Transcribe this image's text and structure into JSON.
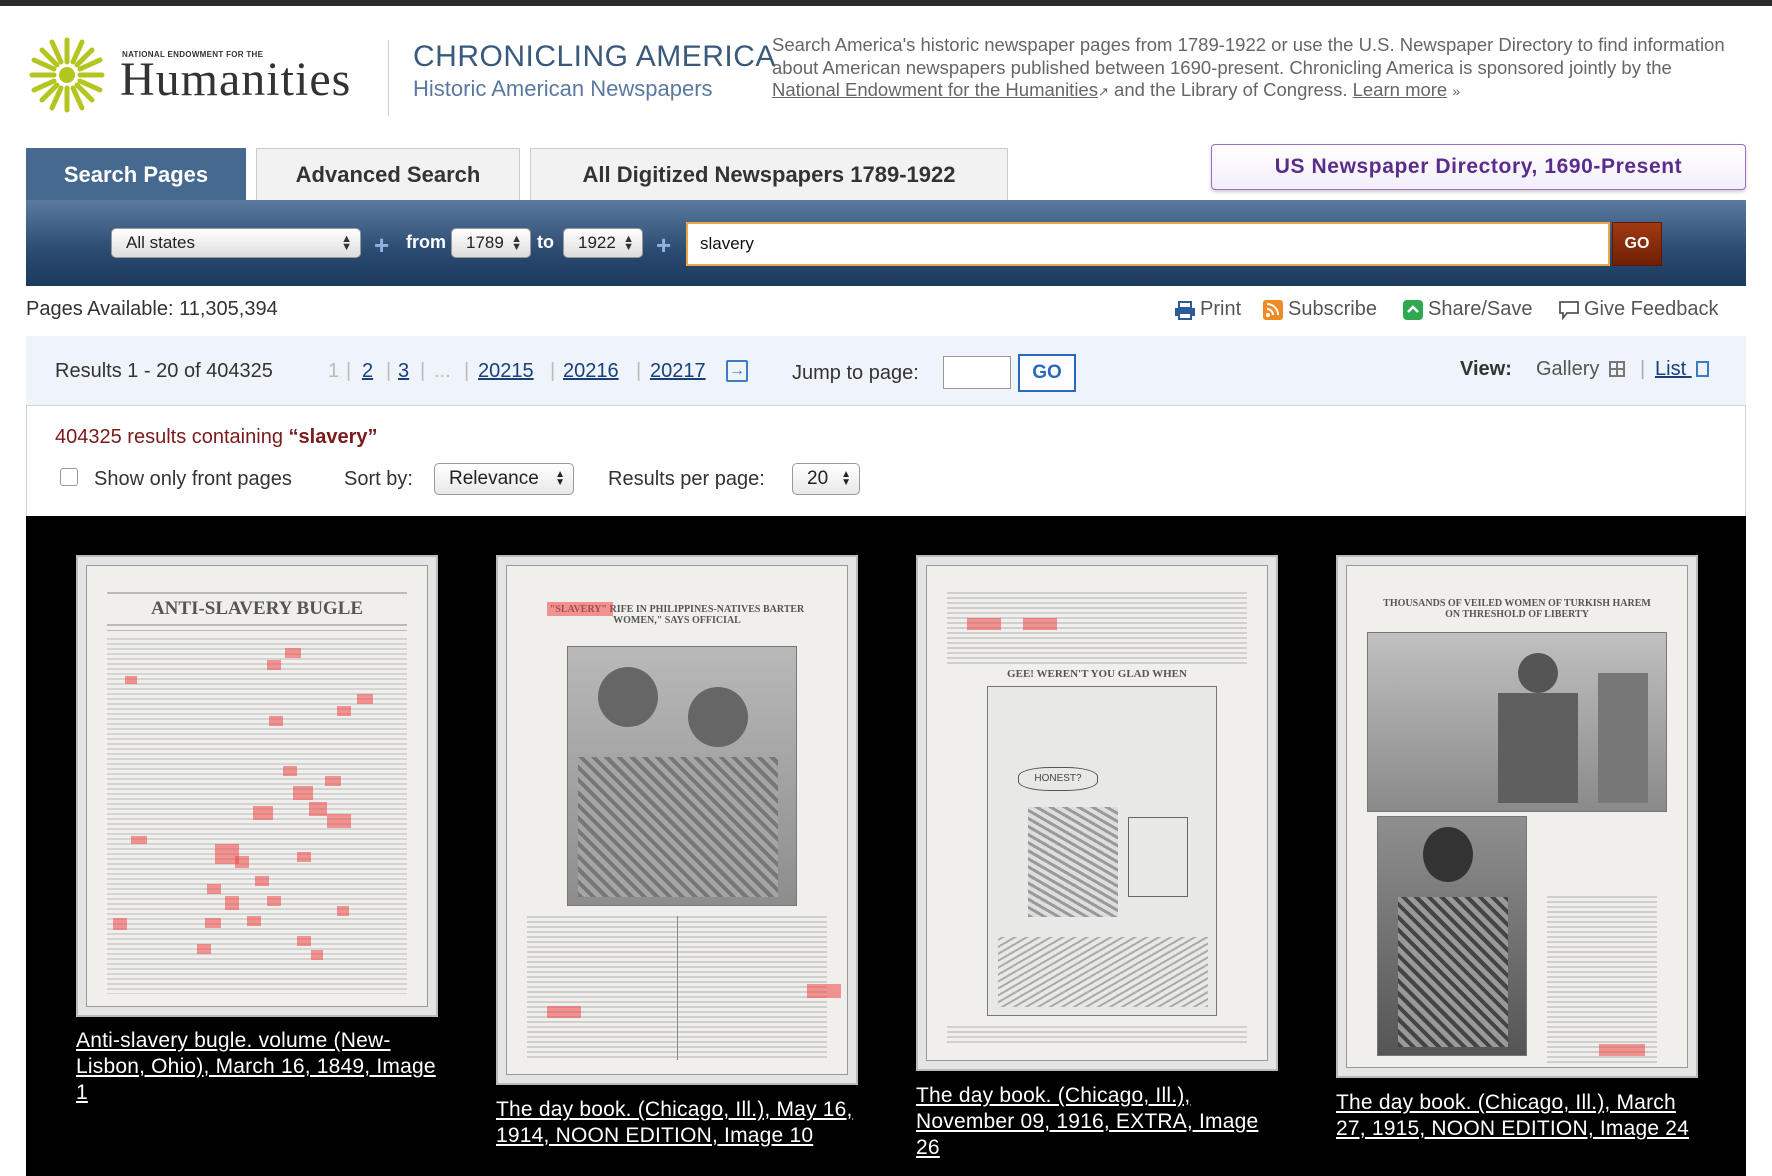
{
  "header": {
    "logo_small": "NATIONAL ENDOWMENT FOR THE",
    "logo_big": "Humanities",
    "site_title": "CHRONICLING AMERICA",
    "site_subtitle": "Historic American Newspapers",
    "intro_text": "Search America's historic newspaper pages from 1789-1922 or use the U.S. Newspaper Directory to find information about American newspapers published between 1690-present. Chronicling America is sponsored jointly by the",
    "intro_link": "National Endowment for the Humanities",
    "intro_after": "and the Library of Congress.",
    "learn_more": "Learn more",
    "learn_more_arrow": "»"
  },
  "tabs": [
    {
      "label": "Search Pages"
    },
    {
      "label": "Advanced Search"
    },
    {
      "label": "All Digitized Newspapers 1789-1922"
    }
  ],
  "directory_button": "US Newspaper Directory, 1690-Present",
  "search": {
    "state": "All states",
    "from_label": "from",
    "from_year": "1789",
    "to_label": "to",
    "to_year": "1922",
    "query": "slavery",
    "go": "GO",
    "plus": "+"
  },
  "pages_available": "Pages Available: 11,305,394",
  "tools": {
    "print": "Print",
    "subscribe": "Subscribe",
    "share": "Share/Save",
    "feedback": "Give Feedback"
  },
  "pagination": {
    "results_text": "Results 1 - 20 of 404325",
    "current": "1",
    "p2": "2",
    "p3": "3",
    "ellipsis": "...",
    "p4": "20215",
    "p5": "20216",
    "p6": "20217",
    "jump_label": "Jump to page:",
    "jump_go": "GO",
    "view_label": "View:",
    "view_gallery": "Gallery",
    "view_list": "List"
  },
  "summary": {
    "count_prefix": "404325 results containing",
    "term": "“slavery”"
  },
  "options": {
    "front_pages": "Show only front pages",
    "sort_label": "Sort by:",
    "sort_value": "Relevance",
    "per_page_label": "Results per page:",
    "per_page_value": "20"
  },
  "results": [
    {
      "caption": "Anti-slavery bugle. volume (New-Lisbon, Ohio), March 16, 1849, Image 1",
      "masthead": "ANTI-SLAVERY BUGLE"
    },
    {
      "caption": "The day book. (Chicago, Ill.), May 16, 1914, NOON EDITION, Image 10",
      "masthead": "\"SLAVERY\" RIFE IN PHILIPPINES-NATIVES BARTER WOMEN,\" SAYS OFFICIAL"
    },
    {
      "caption": "The day book. (Chicago, Ill.), November 09, 1916, EXTRA, Image 26",
      "masthead": "GEE! WEREN'T YOU GLAD WHEN"
    },
    {
      "caption": "The day book. (Chicago, Ill.), March 27, 1915, NOON EDITION, Image 24",
      "masthead": "THOUSANDS OF VEILED WOMEN OF TURKISH HAREM ON THRESHOLD OF LIBERTY"
    }
  ]
}
